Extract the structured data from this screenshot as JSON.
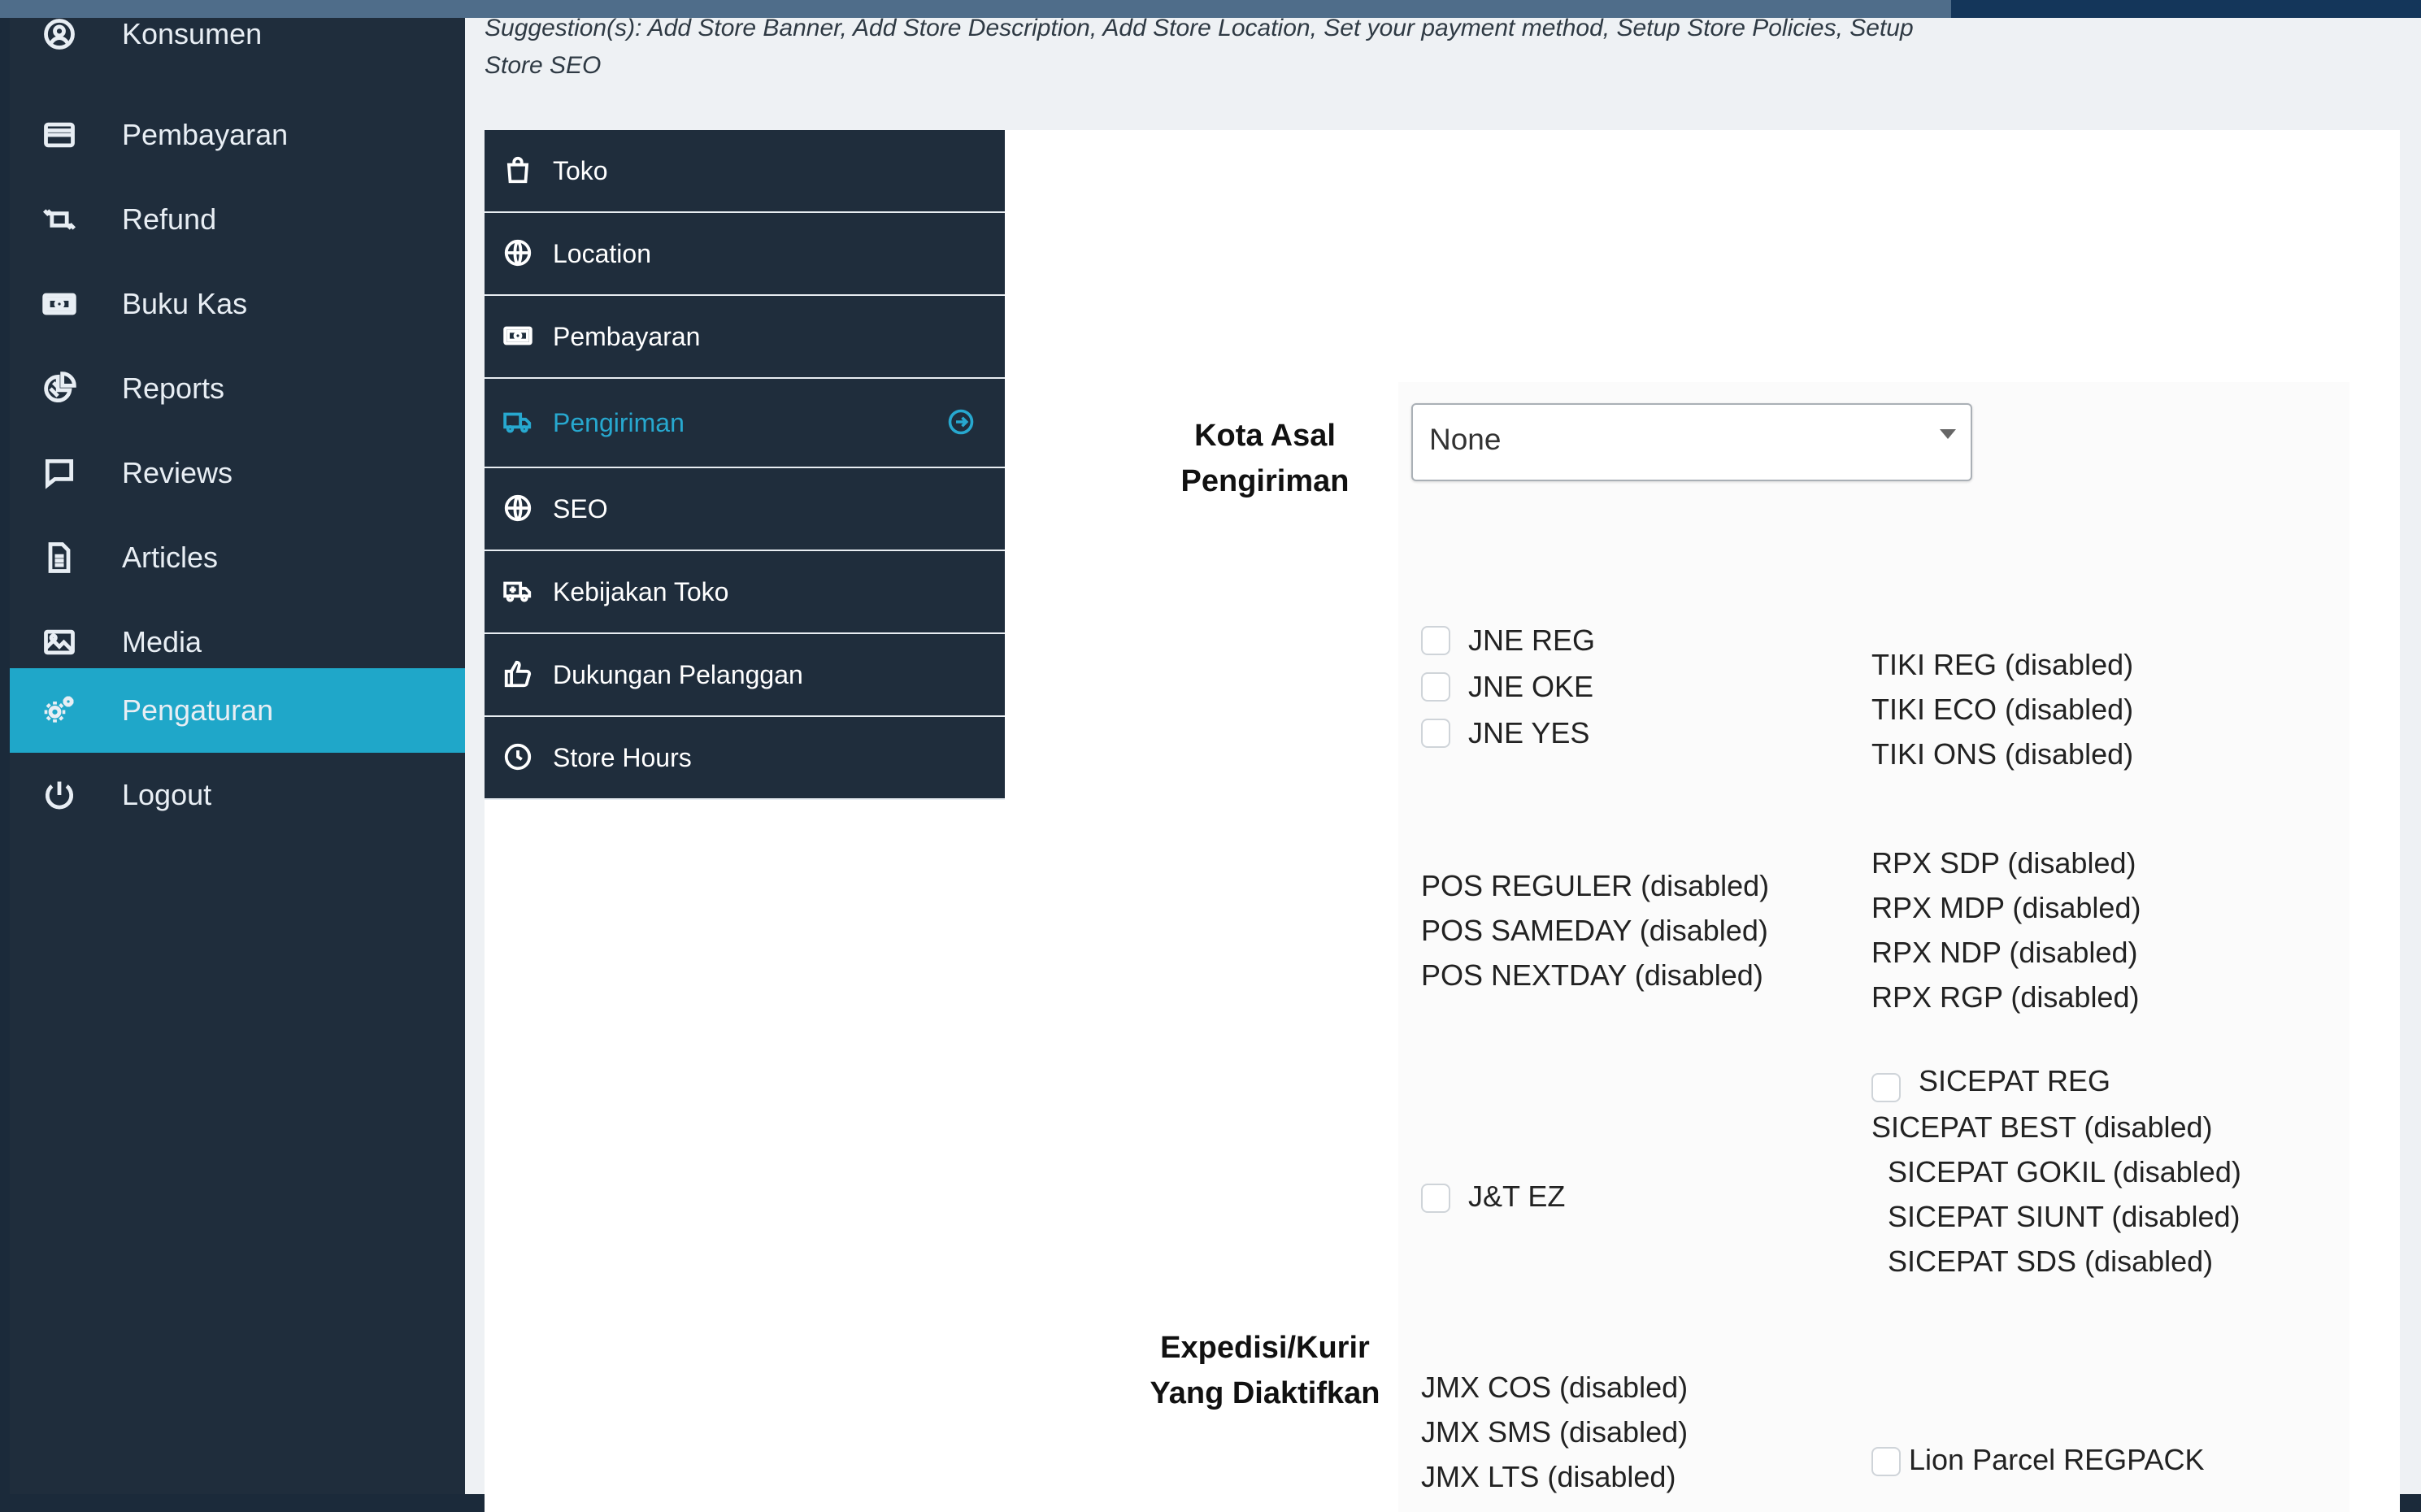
{
  "suggestion": {
    "line1": "Suggestion(s): Add Store Banner, Add Store Description, Add Store Location, Set your payment method, Setup Store Policies, Setup",
    "line2": "Store SEO"
  },
  "sidebar": {
    "items": [
      {
        "label": "Konsumen",
        "icon": "user-circle-icon"
      },
      {
        "label": "Pembayaran",
        "icon": "credit-card-icon"
      },
      {
        "label": "Refund",
        "icon": "refund-icon"
      },
      {
        "label": "Buku Kas",
        "icon": "cash-icon"
      },
      {
        "label": "Reports",
        "icon": "pie-chart-icon"
      },
      {
        "label": "Reviews",
        "icon": "chat-icon"
      },
      {
        "label": "Articles",
        "icon": "document-icon"
      },
      {
        "label": "Media",
        "icon": "image-icon"
      },
      {
        "label": "Pengaturan",
        "icon": "gears-icon",
        "active": true
      },
      {
        "label": "Logout",
        "icon": "power-icon"
      }
    ],
    "active_color": "#1fa7c9"
  },
  "submenu": {
    "items": [
      {
        "label": "Toko",
        "icon": "shopping-bag-icon"
      },
      {
        "label": "Location",
        "icon": "globe-icon"
      },
      {
        "label": "Pembayaran",
        "icon": "cash-icon"
      },
      {
        "label": "Pengiriman",
        "icon": "truck-icon",
        "active": true
      },
      {
        "label": "SEO",
        "icon": "globe-icon"
      },
      {
        "label": "Kebijakan Toko",
        "icon": "ambulance-icon"
      },
      {
        "label": "Dukungan Pelanggan",
        "icon": "thumbs-up-icon"
      },
      {
        "label": "Store Hours",
        "icon": "clock-icon"
      }
    ],
    "active_color": "#27a8cf"
  },
  "form": {
    "origin_label_line1": "Kota Asal",
    "origin_label_line2": "Pengiriman",
    "origin_select_value": "None",
    "couriers_label_line1": "Expedisi/Kurir",
    "couriers_label_line2": "Yang Diaktifkan",
    "options": {
      "jne_reg": "JNE REG",
      "jne_oke": "JNE OKE",
      "jne_yes": "JNE YES",
      "tiki_reg": "TIKI REG (disabled)",
      "tiki_eco": "TIKI ECO (disabled)",
      "tiki_ons": "TIKI ONS (disabled)",
      "pos_reguler": "POS REGULER (disabled)",
      "pos_sameday": "POS SAMEDAY (disabled)",
      "pos_nextday": "POS NEXTDAY (disabled)",
      "rpx_sdp": "RPX SDP (disabled)",
      "rpx_mdp": "RPX MDP (disabled)",
      "rpx_ndp": "RPX NDP (disabled)",
      "rpx_rgp": "RPX RGP (disabled)",
      "sicepat_reg": "SICEPAT REG",
      "sicepat_best": "SICEPAT BEST (disabled)",
      "sicepat_gokil": "SICEPAT GOKIL (disabled)",
      "sicepat_siunt": "SICEPAT SIUNT (disabled)",
      "sicepat_sds": "SICEPAT SDS (disabled)",
      "jnt_ez": "J&T EZ",
      "jmx_cos": "JMX COS (disabled)",
      "jmx_sms": "JMX SMS (disabled)",
      "jmx_lts": "JMX LTS (disabled)",
      "lion_regpack": "Lion Parcel REGPACK"
    }
  }
}
